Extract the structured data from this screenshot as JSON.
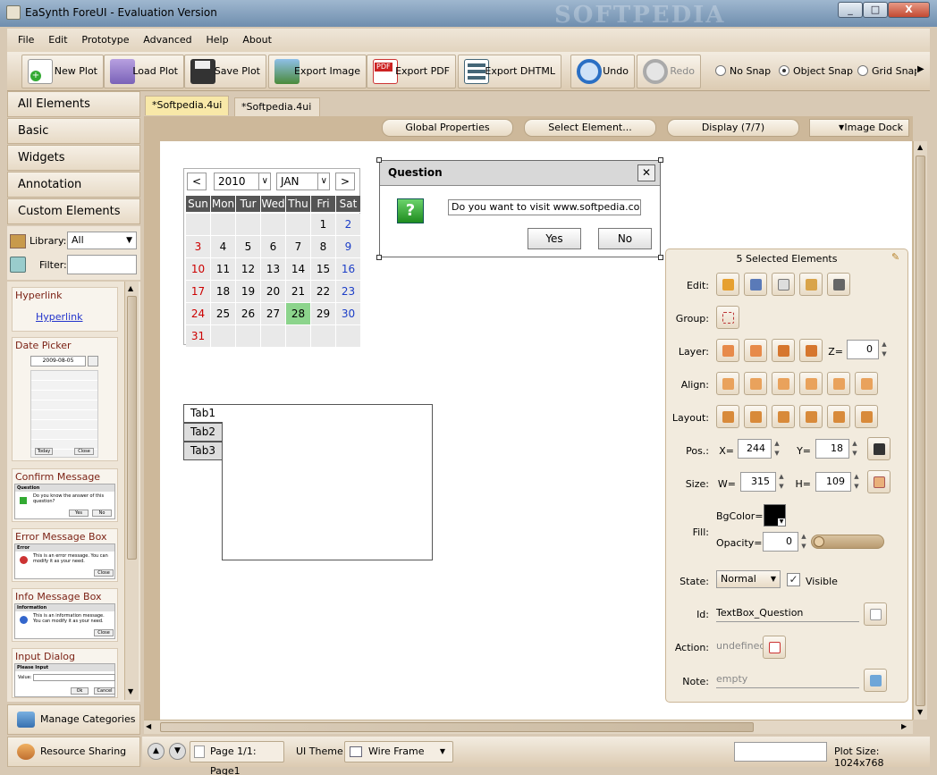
{
  "window": {
    "title": "EaSynth ForeUI - Evaluation Version",
    "minimize": "_",
    "maximize": "□",
    "close": "X",
    "watermark": "SOFTPEDIA"
  },
  "menu": [
    "File",
    "Edit",
    "Prototype",
    "Advanced",
    "Help",
    "About"
  ],
  "toolbar": {
    "new_plot": "New Plot",
    "load_plot": "Load Plot",
    "save_plot": "Save Plot",
    "export_image": "Export Image",
    "export_pdf": "Export PDF",
    "export_dhtml": "Export DHTML",
    "undo": "Undo",
    "redo": "Redo",
    "snap": [
      "No Snap",
      "Object Snap",
      "Grid Snap"
    ],
    "snap_selected": "Object Snap"
  },
  "categories": [
    "All Elements",
    "Basic",
    "Widgets",
    "Annotation",
    "Custom Elements"
  ],
  "library": {
    "label": "Library:",
    "value": "All",
    "filter_label": "Filter:"
  },
  "components": {
    "hyperlink": {
      "title": "Hyperlink",
      "sample": "Hyperlink"
    },
    "datepicker": {
      "title": "Date Picker",
      "date": "2009-08-05",
      "today": "Today",
      "close": "Close"
    },
    "confirm": {
      "title": "Confirm Message Box",
      "win": "Question",
      "text": "Do you know the answer of this question?",
      "yes": "Yes",
      "no": "No"
    },
    "error": {
      "title": "Error Message Box",
      "win": "Error",
      "text": "This is an error message. You can modify it as your need.",
      "close": "Close"
    },
    "info": {
      "title": "Info Message Box",
      "win": "Information",
      "text": "This is an information message. You can modify it as your need.",
      "close": "Close"
    },
    "input": {
      "title": "Input Dialog",
      "win": "Please Input",
      "value": "Value:",
      "ok": "Ok",
      "cancel": "Cancel"
    }
  },
  "left_bottom": {
    "manage": "Manage Categories",
    "sharing": "Resource Sharing"
  },
  "tabs": [
    "*Softpedia.4ui",
    "*Softpedia.4ui"
  ],
  "canvas_controls": {
    "global": "Global Properties",
    "select": "Select Element...",
    "display": "Display (7/7)",
    "dock": "Image Dock"
  },
  "calendar": {
    "year": "2010",
    "month": "JAN",
    "days": [
      "Sun",
      "Mon",
      "Tur",
      "Wed",
      "Thu",
      "Fri",
      "Sat"
    ],
    "weeks": [
      [
        "",
        "",
        "",
        "",
        "",
        "1",
        "2"
      ],
      [
        "3",
        "4",
        "5",
        "6",
        "7",
        "8",
        "9"
      ],
      [
        "10",
        "11",
        "12",
        "13",
        "14",
        "15",
        "16"
      ],
      [
        "17",
        "18",
        "19",
        "20",
        "21",
        "22",
        "23"
      ],
      [
        "24",
        "25",
        "26",
        "27",
        "28",
        "29",
        "30"
      ],
      [
        "31",
        "",
        "",
        "",
        "",
        "",
        ""
      ]
    ],
    "today": "28"
  },
  "dialog": {
    "title": "Question",
    "text": "Do you want to visit www.softpedia.com?",
    "yes": "Yes",
    "no": "No"
  },
  "tabset": [
    "Tab1",
    "Tab2",
    "Tab3"
  ],
  "props": {
    "title": "5 Selected Elements",
    "edit": "Edit:",
    "group": "Group:",
    "layer": "Layer:",
    "z_label": "Z=",
    "z": "0",
    "align": "Align:",
    "layout": "Layout:",
    "pos": "Pos.:",
    "x_label": "X=",
    "x": "244",
    "y_label": "Y=",
    "y": "18",
    "size": "Size:",
    "w_label": "W=",
    "w": "315",
    "h_label": "H=",
    "h": "109",
    "fill": "Fill:",
    "bgcolor": "BgColor=",
    "opacity_label": "Opacity=",
    "opacity": "0",
    "state": "State:",
    "state_value": "Normal",
    "visible": "Visible",
    "id": "Id:",
    "id_value": "TextBox_Question",
    "action": "Action:",
    "action_value": "undefined",
    "note": "Note:",
    "note_value": "empty"
  },
  "statusbar": {
    "page": "Page 1/1: Page1",
    "theme_label": "UI Theme:",
    "theme": "Wire Frame",
    "plot_size": "Plot Size: 1024x768"
  }
}
